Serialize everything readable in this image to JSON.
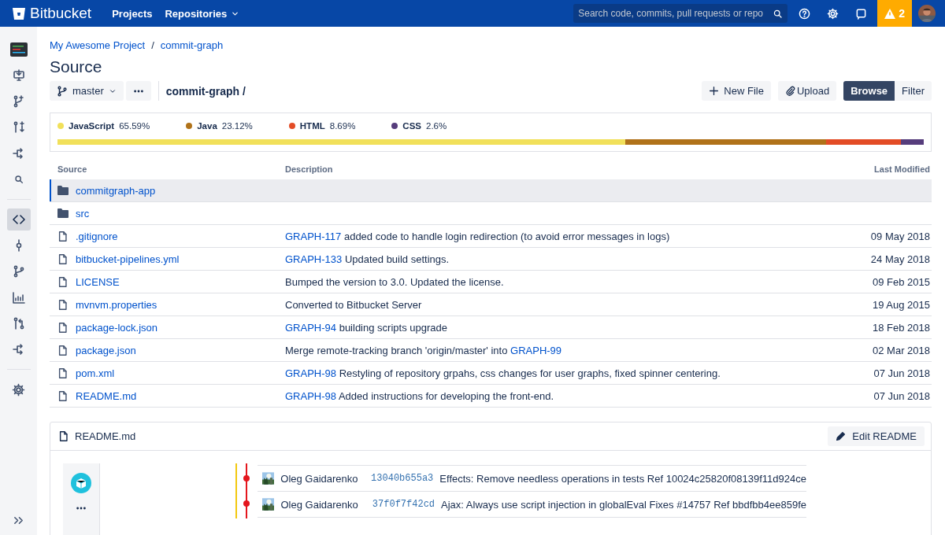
{
  "header": {
    "logo": "Bitbucket",
    "nav": [
      {
        "label": "Projects",
        "dropdown": false
      },
      {
        "label": "Repositories",
        "dropdown": true
      }
    ],
    "search": {
      "placeholder": "Search code, commits, pull requests or repo"
    },
    "alerts": "2"
  },
  "sidebar": {
    "groups": [
      [
        {
          "kind": "avatar",
          "selected": false
        },
        {
          "kind": "clone",
          "selected": false
        },
        {
          "kind": "branch-add",
          "selected": false
        },
        {
          "kind": "pr-add",
          "selected": false
        },
        {
          "kind": "fork",
          "selected": false
        },
        {
          "kind": "search",
          "selected": false
        }
      ],
      [
        {
          "kind": "code",
          "selected": true
        },
        {
          "kind": "commit",
          "selected": false
        },
        {
          "kind": "branch",
          "selected": false
        },
        {
          "kind": "chart",
          "selected": false
        },
        {
          "kind": "pr",
          "selected": false
        },
        {
          "kind": "fork",
          "selected": false
        }
      ],
      [
        {
          "kind": "settings",
          "selected": false
        }
      ]
    ]
  },
  "breadcrumb": {
    "items": [
      "My Awesome Project",
      "commit-graph"
    ],
    "separator": "/"
  },
  "title": "Source",
  "toolbar": {
    "branch": "master",
    "path": "commit-graph /",
    "new_file": "New File",
    "upload": "Upload",
    "modes": [
      {
        "label": "Browse",
        "selected": true
      },
      {
        "label": "Filter",
        "selected": false
      }
    ]
  },
  "languages": [
    {
      "name": "JavaScript",
      "percent": "65.59%",
      "color": "#f1e05a"
    },
    {
      "name": "Java",
      "percent": "23.12%",
      "color": "#b07219"
    },
    {
      "name": "HTML",
      "percent": "8.69%",
      "color": "#e34c26"
    },
    {
      "name": "CSS",
      "percent": "2.6%",
      "color": "#563d7c"
    }
  ],
  "table": {
    "columns": [
      "Source",
      "Description",
      "Last Modified"
    ],
    "rows": [
      {
        "kind": "folder",
        "name": "commitgraph-app",
        "selected": true,
        "description": [],
        "modified": ""
      },
      {
        "kind": "folder",
        "name": "src",
        "selected": false,
        "description": [],
        "modified": ""
      },
      {
        "kind": "file",
        "name": ".gitignore",
        "selected": false,
        "description": [
          {
            "kind": "link",
            "text": "GRAPH-117"
          },
          {
            "kind": "text",
            "text": "added code to handle login redirection (to avoid error messages in logs)"
          }
        ],
        "modified": "09 May 2018"
      },
      {
        "kind": "file",
        "name": "bitbucket-pipelines.yml",
        "selected": false,
        "description": [
          {
            "kind": "link",
            "text": "GRAPH-133"
          },
          {
            "kind": "text",
            "text": "Updated build settings."
          }
        ],
        "modified": "24 May 2018"
      },
      {
        "kind": "file",
        "name": "LICENSE",
        "selected": false,
        "description": [
          {
            "kind": "text",
            "text": "Bumped the version to 3.0. Updated the license."
          }
        ],
        "modified": "09 Feb 2015"
      },
      {
        "kind": "file",
        "name": "mvnvm.properties",
        "selected": false,
        "description": [
          {
            "kind": "text",
            "text": "Converted to Bitbucket Server"
          }
        ],
        "modified": "19 Aug 2015"
      },
      {
        "kind": "file",
        "name": "package-lock.json",
        "selected": false,
        "description": [
          {
            "kind": "link",
            "text": "GRAPH-94"
          },
          {
            "kind": "text",
            "text": "building scripts upgrade"
          }
        ],
        "modified": "18 Feb 2018"
      },
      {
        "kind": "file",
        "name": "package.json",
        "selected": false,
        "description": [
          {
            "kind": "text",
            "text": "Merge remote-tracking branch 'origin/master' into"
          },
          {
            "kind": "link",
            "text": "GRAPH-99"
          }
        ],
        "modified": "02 Mar 2018"
      },
      {
        "kind": "file",
        "name": "pom.xml",
        "selected": false,
        "description": [
          {
            "kind": "link",
            "text": "GRAPH-98"
          },
          {
            "kind": "text",
            "text": "Restyling of repository grpahs, css changes for user graphs, fixed spinner centering."
          }
        ],
        "modified": "07 Jun 2018"
      },
      {
        "kind": "file",
        "name": "README.md",
        "selected": false,
        "description": [
          {
            "kind": "link",
            "text": "GRAPH-98"
          },
          {
            "kind": "text",
            "text": "Added instructions for developing the front-end."
          }
        ],
        "modified": "07 Jun 2018"
      }
    ]
  },
  "readme": {
    "title": "README.md",
    "edit_button": "Edit README",
    "commits": [
      {
        "author": "Oleg Gaidarenko",
        "hash": "13040b655a3",
        "message": "Effects: Remove needless operations in tests Ref 10024c25820f08139f11d924ce"
      },
      {
        "author": "Oleg Gaidarenko",
        "hash": "37f0f7f42cd",
        "message": "Ajax: Always use script injection in globalEval Fixes #14757 Ref bbdfbb4ee859fe"
      }
    ]
  }
}
